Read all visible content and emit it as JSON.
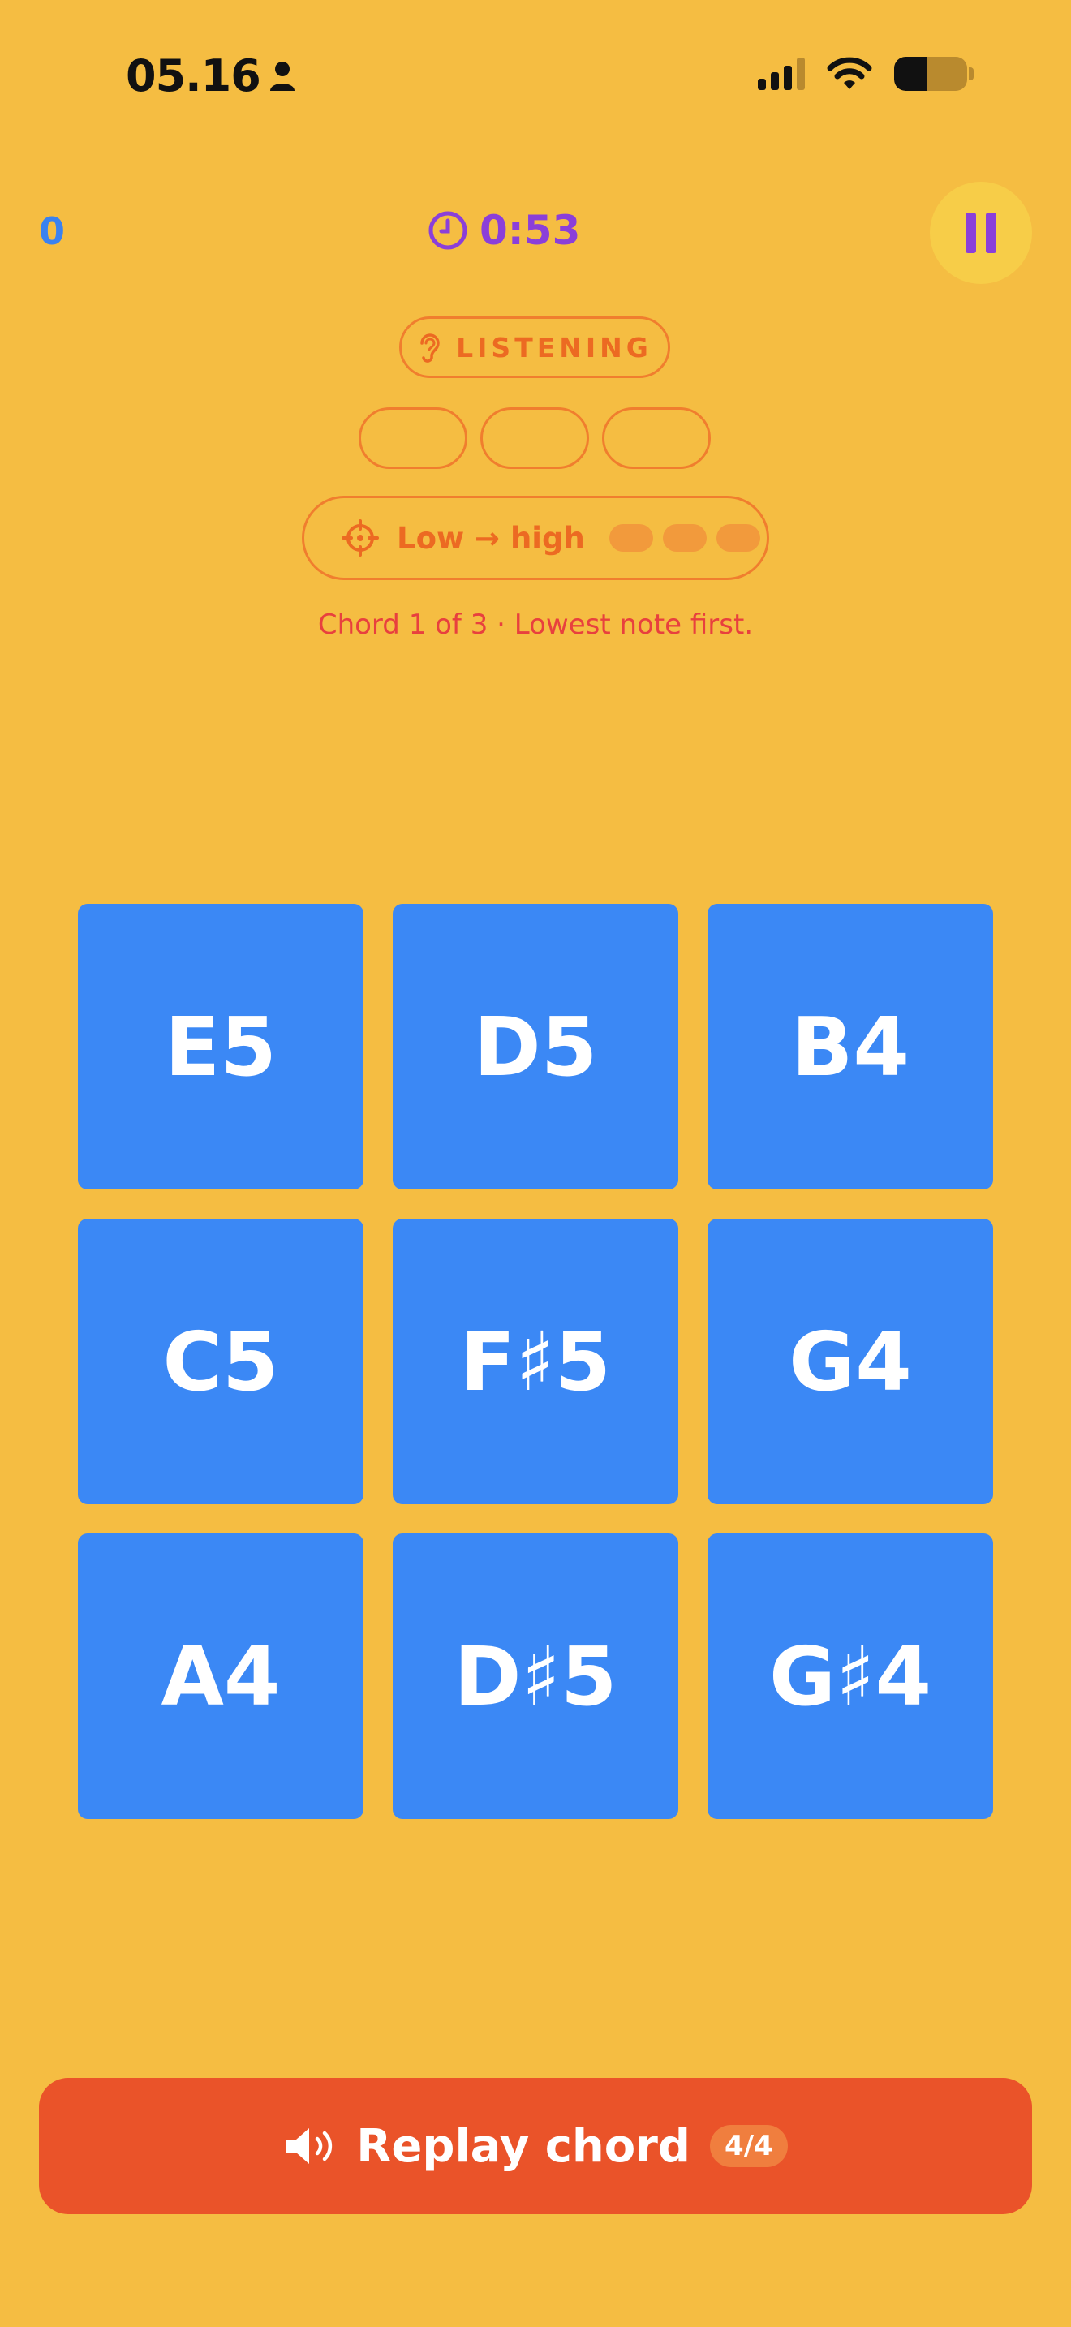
{
  "status_bar": {
    "time": "05.16",
    "icons": [
      "person-icon",
      "signal-icon",
      "wifi-icon",
      "battery-icon"
    ]
  },
  "header": {
    "score": "0",
    "timer": "0:53",
    "timer_icon": "clock-icon",
    "pause_icon": "pause-icon"
  },
  "mode": {
    "icon": "ear-icon",
    "label": "LISTENING"
  },
  "answer_slots": 3,
  "order": {
    "icon": "target-icon",
    "label": "Low → high",
    "progress_dots": 3
  },
  "hint": "Chord 1 of 3 · Lowest note first.",
  "keys": [
    "E5",
    "D5",
    "B4",
    "C5",
    "F♯5",
    "G4",
    "A4",
    "D♯5",
    "G♯4"
  ],
  "replay": {
    "icon": "speaker-icon",
    "label": "Replay chord",
    "count": "4/4"
  },
  "colors": {
    "background": "#F5BD42",
    "key": "#3B88F5",
    "accent_orange": "#EC6A22",
    "replay": "#EA5329",
    "purple": "#8B3FD9",
    "hint": "#E8403E"
  }
}
